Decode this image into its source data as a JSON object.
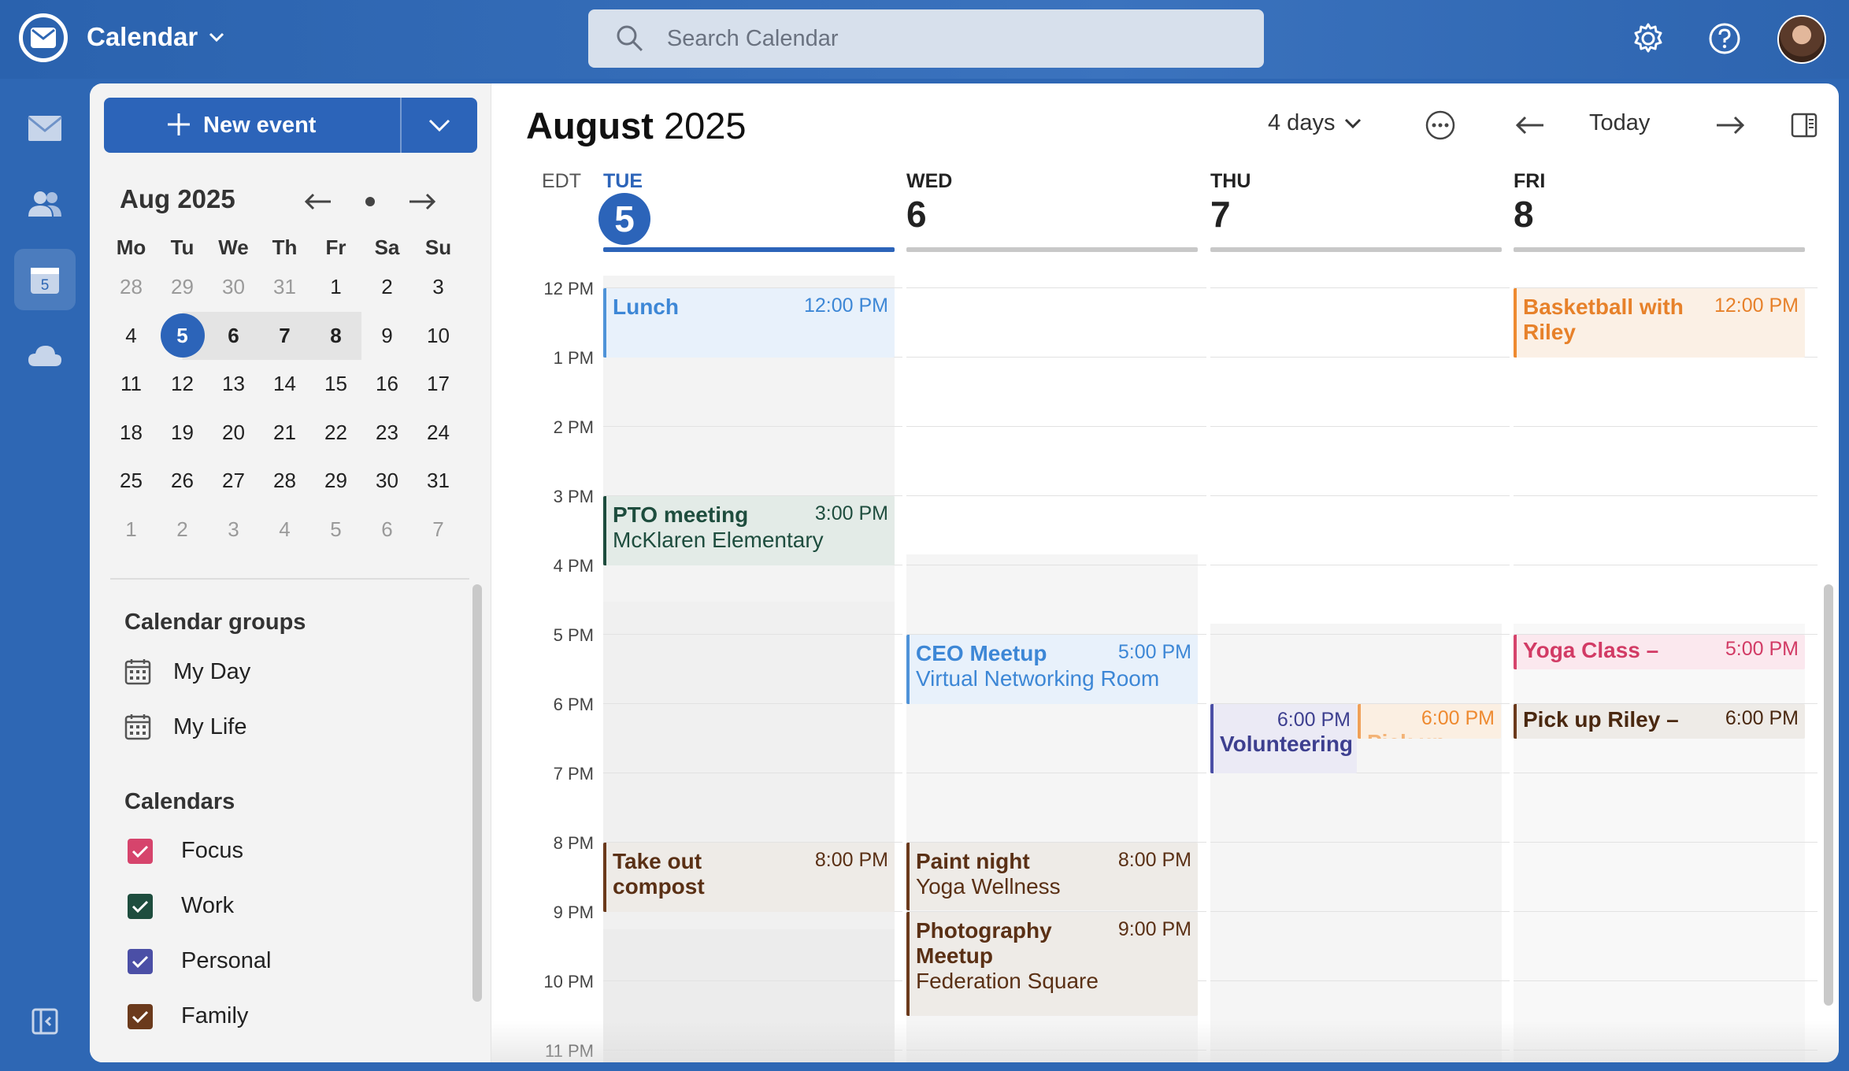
{
  "app": {
    "title": "Calendar"
  },
  "search": {
    "placeholder": "Search Calendar"
  },
  "toolbar": {
    "new_event_label": "New event"
  },
  "mini_calendar": {
    "month_label": "Aug 2025",
    "weekday_headers": [
      "Mo",
      "Tu",
      "We",
      "Th",
      "Fr",
      "Sa",
      "Su"
    ],
    "weeks": [
      [
        "28",
        "29",
        "30",
        "31",
        "1",
        "2",
        "3"
      ],
      [
        "4",
        "5",
        "6",
        "7",
        "8",
        "9",
        "10"
      ],
      [
        "11",
        "12",
        "13",
        "14",
        "15",
        "16",
        "17"
      ],
      [
        "18",
        "19",
        "20",
        "21",
        "22",
        "23",
        "24"
      ],
      [
        "25",
        "26",
        "27",
        "28",
        "29",
        "30",
        "31"
      ],
      [
        "1",
        "2",
        "3",
        "4",
        "5",
        "6",
        "7"
      ]
    ],
    "today": "5"
  },
  "calendar_groups": {
    "title": "Calendar groups",
    "items": [
      "My Day",
      "My Life"
    ]
  },
  "calendars": {
    "title": "Calendars",
    "items": [
      {
        "label": "Focus",
        "color": "#d6446c"
      },
      {
        "label": "Work",
        "color": "#1e4d3e"
      },
      {
        "label": "Personal",
        "color": "#4b4fa6"
      },
      {
        "label": "Family",
        "color": "#6b3a1c"
      }
    ]
  },
  "view": {
    "title_month": "August",
    "title_year": "2025",
    "range_label": "4 days",
    "today_label": "Today",
    "timezone": "EDT",
    "days": [
      {
        "name": "TUE",
        "num": "5",
        "today": true
      },
      {
        "name": "WED",
        "num": "6"
      },
      {
        "name": "THU",
        "num": "7"
      },
      {
        "name": "FRI",
        "num": "8"
      }
    ],
    "hours": [
      "12 PM",
      "1 PM",
      "2 PM",
      "3 PM",
      "4 PM",
      "5 PM",
      "6 PM",
      "7 PM",
      "8 PM",
      "9 PM",
      "10 PM",
      "11 PM"
    ]
  },
  "events": {
    "lunch": {
      "title": "Lunch",
      "time": "12:00 PM"
    },
    "pto": {
      "title": "PTO meeting",
      "time": "3:00 PM",
      "location": "McKlaren Elementary"
    },
    "compost": {
      "title": "Take out compost",
      "time": "8:00 PM"
    },
    "ceo": {
      "title": "CEO Meetup",
      "time": "5:00 PM",
      "location": "Virtual Networking Room"
    },
    "paint": {
      "title": "Paint night",
      "time": "8:00 PM",
      "location": "Yoga Wellness"
    },
    "photo": {
      "title": "Photography Meetup",
      "time": "9:00 PM",
      "location": "Federation Square"
    },
    "volunteer": {
      "title": "Volunteering",
      "time": "6:00 PM"
    },
    "pickup_thu": {
      "title": "Pick up",
      "time": "6:00 PM"
    },
    "basketball": {
      "title": "Basketball with Riley",
      "time": "12:00 PM"
    },
    "yoga": {
      "title": "Yoga Class –",
      "time": "5:00 PM"
    },
    "pickup_fri": {
      "title": "Pick up Riley –",
      "time": "6:00 PM"
    }
  },
  "colors": {
    "accent": "#2c64b9",
    "topbar": "#2e67b4"
  }
}
